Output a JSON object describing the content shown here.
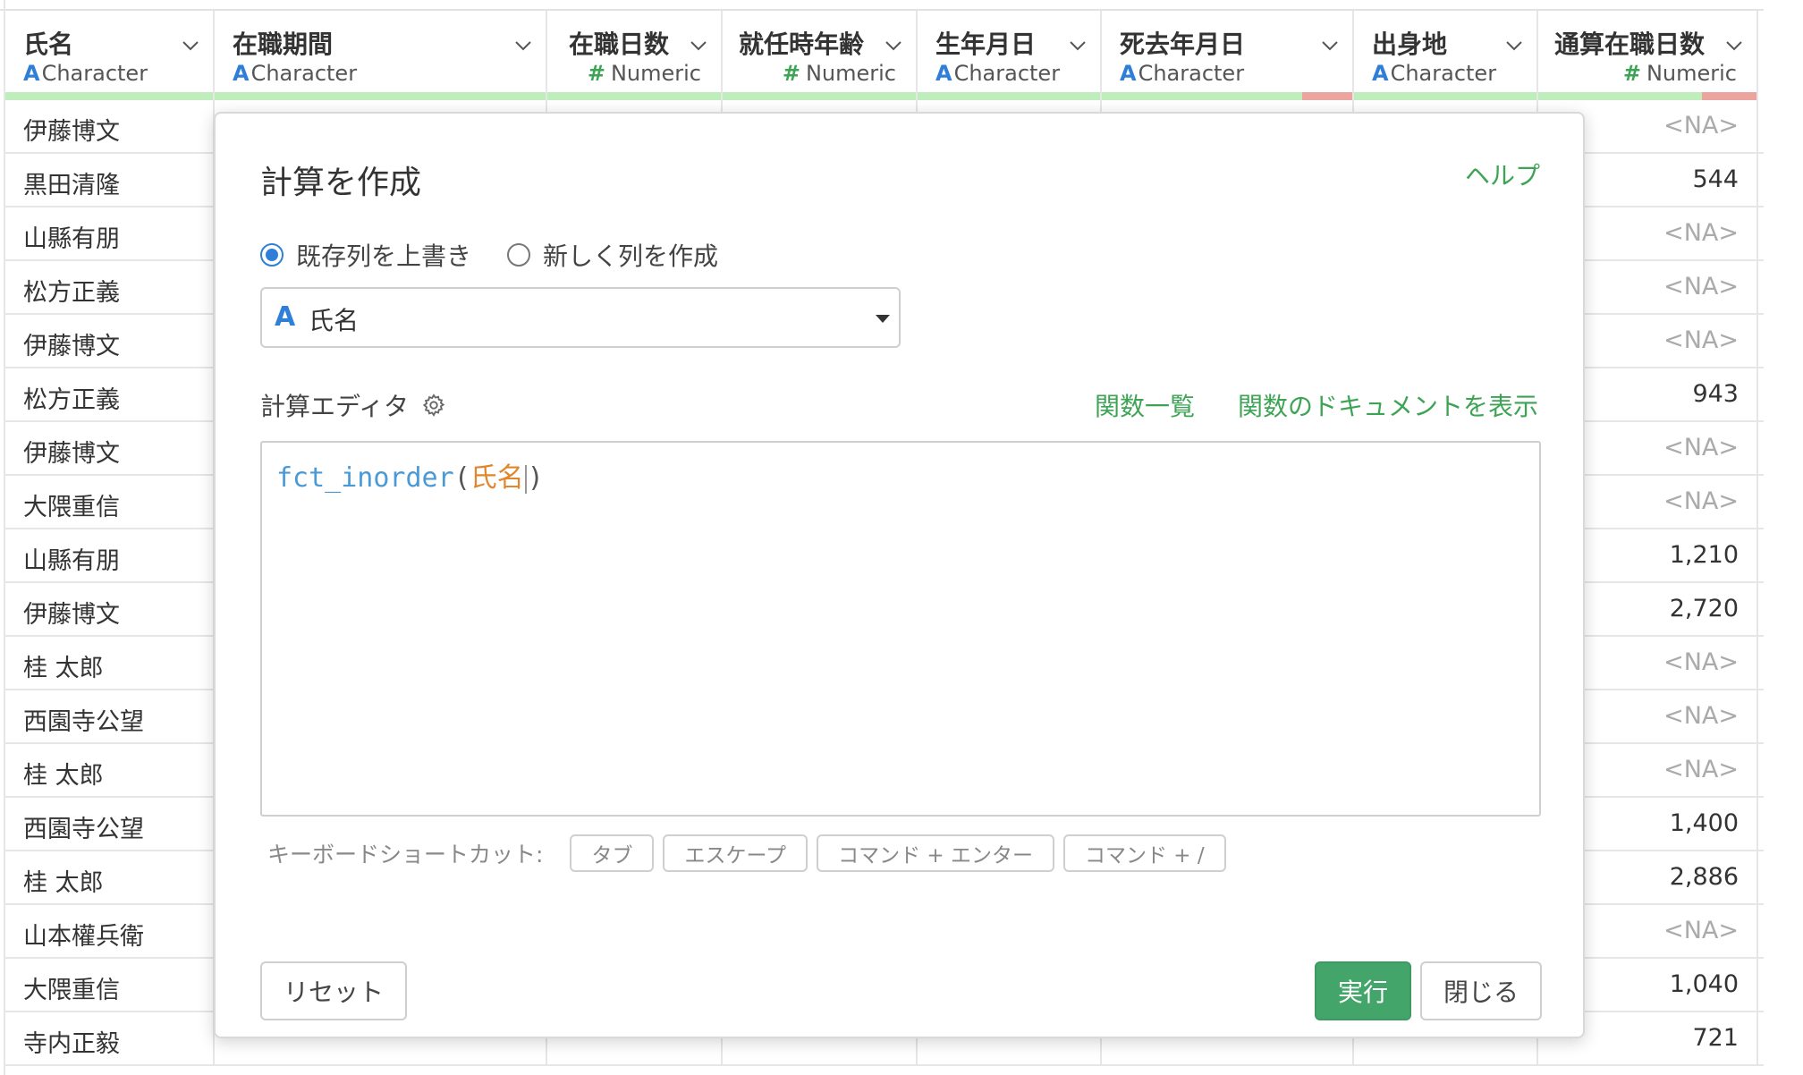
{
  "table": {
    "columns": [
      {
        "name": "氏名",
        "type_icon": "A",
        "type": "Character",
        "kind": "char",
        "width": 234,
        "red_fraction": 0
      },
      {
        "name": "在職期間",
        "type_icon": "A",
        "type": "Character",
        "kind": "char",
        "width": 372,
        "red_fraction": 0
      },
      {
        "name": "在職日数",
        "type_icon": "#",
        "type": "Numeric",
        "kind": "num",
        "width": 196,
        "red_fraction": 0
      },
      {
        "name": "就任時年齢",
        "type_icon": "#",
        "type": "Numeric",
        "kind": "num",
        "width": 218,
        "red_fraction": 0
      },
      {
        "name": "生年月日",
        "type_icon": "A",
        "type": "Character",
        "kind": "char",
        "width": 206,
        "red_fraction": 0
      },
      {
        "name": "死去年月日",
        "type_icon": "A",
        "type": "Character",
        "kind": "char",
        "width": 282,
        "red_fraction": 0.2
      },
      {
        "name": "出身地",
        "type_icon": "A",
        "type": "Character",
        "kind": "char",
        "width": 206,
        "red_fraction": 0
      },
      {
        "name": "通算在職日数",
        "type_icon": "#",
        "type": "Numeric",
        "kind": "num",
        "width": 246,
        "red_fraction": 0.25
      }
    ],
    "rows": [
      {
        "name": "伊藤博文",
        "total": "<NA>"
      },
      {
        "name": "黒田清隆",
        "total": "544"
      },
      {
        "name": "山縣有朋",
        "total": "<NA>"
      },
      {
        "name": "松方正義",
        "total": "<NA>"
      },
      {
        "name": "伊藤博文",
        "total": "<NA>"
      },
      {
        "name": "松方正義",
        "total": "943"
      },
      {
        "name": "伊藤博文",
        "total": "<NA>"
      },
      {
        "name": "大隈重信",
        "total": "<NA>"
      },
      {
        "name": "山縣有朋",
        "total": "1,210"
      },
      {
        "name": "伊藤博文",
        "total": "2,720"
      },
      {
        "name": "桂 太郎",
        "total": "<NA>"
      },
      {
        "name": "西園寺公望",
        "total": "<NA>"
      },
      {
        "name": "桂 太郎",
        "total": "<NA>"
      },
      {
        "name": "西園寺公望",
        "total": "1,400"
      },
      {
        "name": "桂 太郎",
        "total": "2,886"
      },
      {
        "name": "山本權兵衛",
        "total": "<NA>"
      },
      {
        "name": "大隈重信",
        "total": "1,040"
      },
      {
        "name": "寺内正毅",
        "total": "721"
      }
    ]
  },
  "dialog": {
    "title": "計算を作成",
    "help": "ヘルプ",
    "radio_overwrite": "既存列を上書き",
    "radio_new": "新しく列を作成",
    "selected_column_icon": "A",
    "selected_column": "氏名",
    "editor_label": "計算エディタ",
    "function_list": "関数一覧",
    "show_docs": "関数のドキュメントを表示",
    "code_fn": "fct_inorder",
    "code_open": "(",
    "code_arg": "氏名",
    "code_close": ")",
    "shortcut_label": "キーボードショートカット:",
    "shortcuts": [
      "タブ",
      "エスケープ",
      "コマンド + エンター",
      "コマンド + /"
    ],
    "reset": "リセット",
    "run": "実行",
    "close": "閉じる"
  },
  "colors": {
    "accent_green": "#3ea455",
    "run_button": "#44a56b",
    "type_char_blue": "#2f7fd8",
    "quality_ok": "#bfeebc",
    "quality_bad": "#eba59e"
  }
}
